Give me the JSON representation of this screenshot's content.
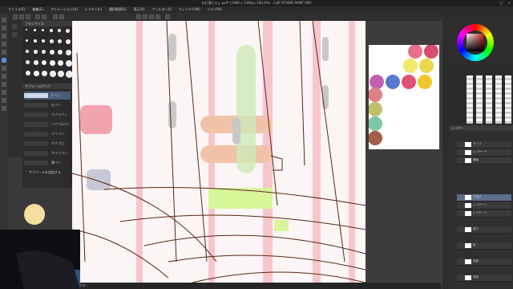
{
  "window": {
    "title": "ねむ漫たきょ.psd* (1480 x 3300px 100.0%)  - CLIP STUDIO PAINT PRO"
  },
  "menu": [
    "ファイル(F)",
    "編集(E)",
    "アニメーション(A)",
    "レイヤー(L)",
    "選択範囲(S)",
    "表示(V)",
    "フィルター(I)",
    "ウィンドウ(W)",
    "ヘルプ(H)"
  ],
  "brush_panel": {
    "title": "ブラシサイズ"
  },
  "tool_property": {
    "title": "サブツール[ペン]",
    "items": [
      "Gペン",
      "丸ペン",
      "カブラペン",
      "リアルGペン",
      "ミリペン",
      "ケチプロ",
      "サインペン",
      "筆ペン"
    ]
  },
  "subtool_footer": "サブツールを追加する",
  "colors": {
    "main": "#7a1e1e",
    "sub": "#ffffff"
  },
  "layers": {
    "title": "レイヤー",
    "items": [
      {
        "name": "100 % 通常",
        "sub": "セリフ"
      },
      {
        "name": "100 % 通常",
        "sub": "レイヤー 3"
      },
      {
        "name": "100 % 通常",
        "sub": "線画"
      },
      {
        "name": "100 % 通常",
        "sub": "下描き",
        "selected": true
      },
      {
        "name": "100 % 通常",
        "sub": "レイヤー 1"
      },
      {
        "name": "100 % 通常",
        "sub": "レイヤー 2"
      },
      {
        "name": "100 % 通常",
        "sub": "塗り"
      },
      {
        "name": "100 % 通常",
        "sub": "影"
      },
      {
        "name": "100 % 通常",
        "sub": "背景"
      },
      {
        "name": "100 % 通常",
        "sub": "用紙"
      }
    ]
  },
  "status": {
    "zoom": "100.0"
  }
}
